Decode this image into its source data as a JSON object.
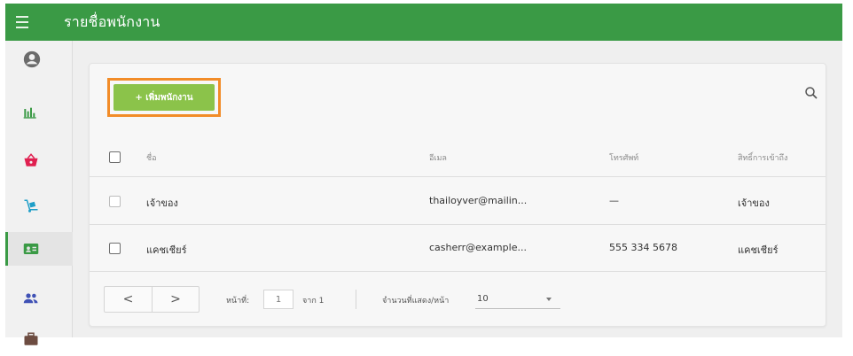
{
  "topbar": {
    "title": "รายชื่อพนักงาน",
    "bg_color": "#3a9a45"
  },
  "sidebar": {
    "items": [
      {
        "icon": "account-circle-icon",
        "color": "#6b6b6b",
        "active": false
      },
      {
        "icon": "bar-chart-icon",
        "color": "#3a9a45",
        "active": false
      },
      {
        "icon": "basket-icon",
        "color": "#e02050",
        "active": false
      },
      {
        "icon": "hand-truck-icon",
        "color": "#1e9ec8",
        "active": false
      },
      {
        "icon": "id-card-icon",
        "color": "#3a9a45",
        "active": true
      },
      {
        "icon": "people-icon",
        "color": "#3f51b5",
        "active": false
      },
      {
        "icon": "briefcase-icon",
        "color": "#6d4c41",
        "active": false
      }
    ]
  },
  "toolbar": {
    "add_button_label": "+ เพิ่มพนักงาน",
    "add_button_color": "#8bc34a",
    "highlight_color": "#f28c28",
    "search_icon": "search-icon"
  },
  "table": {
    "headers": {
      "name": "ชื่อ",
      "email": "อีเมล",
      "phone": "โทรศัพท์",
      "role": "สิทธิ์การเข้าถึง"
    },
    "rows": [
      {
        "name": "เจ้าของ",
        "email": "thailoyver@mailin...",
        "phone": "—",
        "role": "เจ้าของ"
      },
      {
        "name": "แคชเชียร์",
        "email": "casherr@example...",
        "phone": "555 334 5678",
        "role": "แคชเชียร์"
      }
    ]
  },
  "pagination": {
    "prev_label": "<",
    "next_label": ">",
    "page_label": "หน้าที่:",
    "page_value": "1",
    "of_label": "จาก 1",
    "per_page_label": "จำนวนที่แสดง/หน้า",
    "per_page_value": "10"
  }
}
